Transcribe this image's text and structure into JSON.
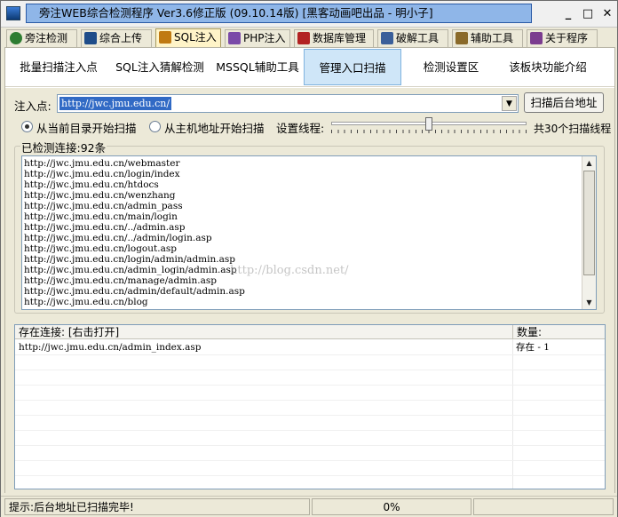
{
  "window": {
    "title": "旁注WEB综合检测程序 Ver3.6修正版 (09.10.14版) [黑客动画吧出品 - 明小子]",
    "minimize": "_",
    "maximize": "□",
    "close": "✕"
  },
  "tabs": [
    {
      "label": "旁注检测",
      "color": "#2e7d32"
    },
    {
      "label": "综合上传",
      "color": "#1f4d8a"
    },
    {
      "label": "SQL注入",
      "color": "#c07a12"
    },
    {
      "label": "PHP注入",
      "color": "#7a4aa8"
    },
    {
      "label": "数据库管理",
      "color": "#b22222"
    },
    {
      "label": "破解工具",
      "color": "#3a5f9a"
    },
    {
      "label": "辅助工具",
      "color": "#8a6a2a"
    },
    {
      "label": "关于程序",
      "color": "#7b3c8f"
    }
  ],
  "subtabs": [
    {
      "label": "批量扫描注入点"
    },
    {
      "label": "SQL注入猜解检测"
    },
    {
      "label": "MSSQL辅助工具"
    },
    {
      "label": "管理入口扫描"
    },
    {
      "label": "检测设置区"
    },
    {
      "label": "该板块功能介绍"
    }
  ],
  "scan": {
    "inject_label": "注入点:",
    "url": "http://jwc.jmu.edu.cn/",
    "scan_button": "扫描后台地址",
    "radio_current": "从当前目录开始扫描",
    "radio_host": "从主机地址开始扫描",
    "threads_label": "设置线程:",
    "threads_text": "共30个扫描线程",
    "threads_fraction": 0.5
  },
  "detected": {
    "title": "已检测连接:92条",
    "lines": [
      "http://jwc.jmu.edu.cn/webmaster",
      "http://jwc.jmu.edu.cn/login/index",
      "http://jwc.jmu.edu.cn/htdocs",
      "http://jwc.jmu.edu.cn/wenzhang",
      "http://jwc.jmu.edu.cn/admin_pass",
      "http://jwc.jmu.edu.cn/main/login",
      "http://jwc.jmu.edu.cn/../admin.asp",
      "http://jwc.jmu.edu.cn/../admin/login.asp",
      "http://jwc.jmu.edu.cn/logout.asp",
      "http://jwc.jmu.edu.cn/login/admin/admin.asp",
      "http://jwc.jmu.edu.cn/admin_login/admin.asp",
      "http://jwc.jmu.edu.cn/manage/admin.asp",
      "http://jwc.jmu.edu.cn/admin/default/admin.asp",
      "http://jwc.jmu.edu.cn/blog"
    ],
    "watermark": "http://blog.csdn.net/"
  },
  "results": {
    "col_link": "存在连接: [右击打开]",
    "col_count": "数量:",
    "rows": [
      {
        "link": "http://jwc.jmu.edu.cn/admin_index.asp",
        "count": "存在 - 1"
      }
    ]
  },
  "status": {
    "message": "提示:后台地址已扫描完毕!",
    "progress": "0%"
  }
}
